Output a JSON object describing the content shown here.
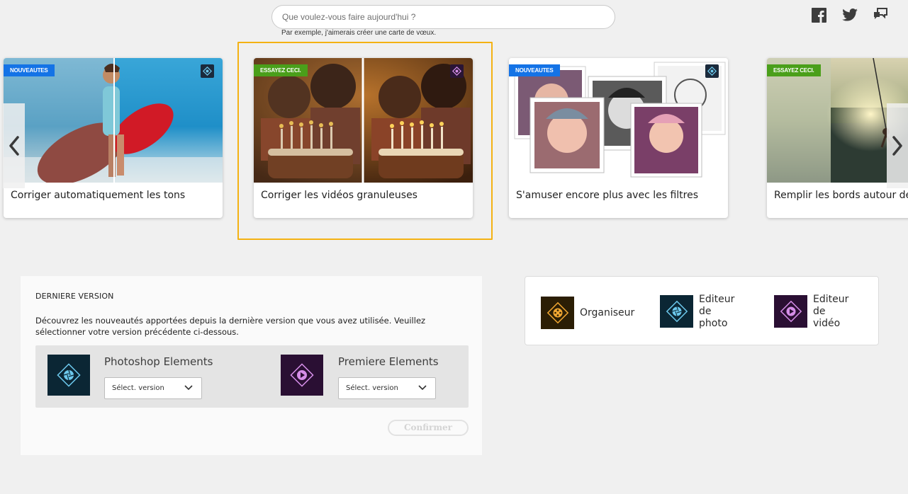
{
  "search": {
    "placeholder": "Que voulez-vous faire aujourd'hui ?",
    "hint": "Par exemple, j'aimerais créer une carte de vœux."
  },
  "social": {
    "items": [
      "facebook-icon",
      "twitter-icon",
      "feedback-icon"
    ]
  },
  "carousel": {
    "cards": [
      {
        "badge": "NOUVEAUTES",
        "badge_color": "#1473e6",
        "caption": "Corriger automatiquement les tons"
      },
      {
        "badge": "ESSAYEZ CECI.",
        "badge_color": "#4a9f1a",
        "caption": "Corriger les vidéos granuleuses"
      },
      {
        "badge": "NOUVEAUTES",
        "badge_color": "#1473e6",
        "caption": "S'amuser encore plus avec les filtres"
      },
      {
        "badge": "ESSAYEZ CECI.",
        "badge_color": "#4a9f1a",
        "caption": "Remplir les bords autour de vos photos"
      }
    ],
    "focus_color": "#f4b213"
  },
  "last_version": {
    "title": "DERNIERE VERSION",
    "description": "Découvrez les nouveautés apportées depuis la dernière version que vous avez utilisée. Veuillez sélectionner votre version précédente ci-dessous.",
    "products": [
      {
        "name": "Photoshop Elements",
        "select": "Sélect. version"
      },
      {
        "name": "Premiere Elements",
        "select": "Sélect. version"
      }
    ],
    "confirm": "Confirmer"
  },
  "apps": {
    "organizer": "Organiseur",
    "photo_editor": [
      "Editeur",
      "de",
      "photo"
    ],
    "video_editor": [
      "Editeur",
      "de",
      "vidéo"
    ]
  }
}
